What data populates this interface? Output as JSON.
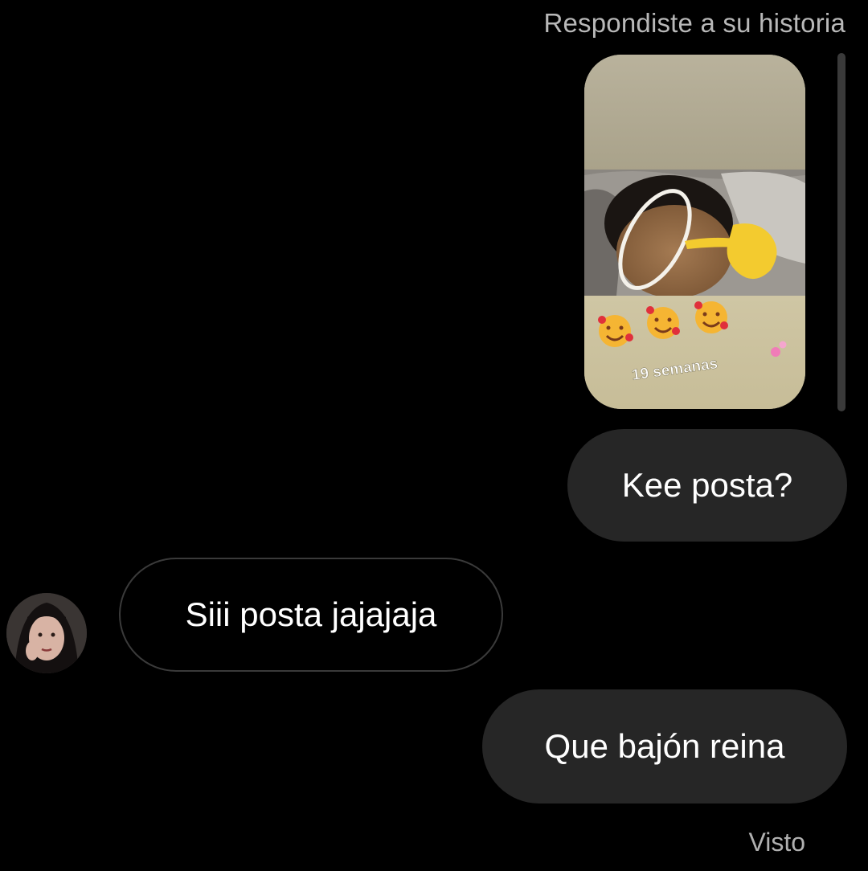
{
  "conversation": {
    "reply_context": "Respondiste a su historia",
    "story": {
      "overlay_text": "19 semanas",
      "stickers": [
        "smiling-face-with-hearts-icon",
        "smiling-face-with-hearts-icon",
        "smiling-face-with-hearts-icon",
        "two-hearts-icon",
        "pointing-hand-icon"
      ]
    },
    "messages": [
      {
        "sender": "me",
        "text": "Kee posta?"
      },
      {
        "sender": "them",
        "text": "Siii posta jajajaja"
      },
      {
        "sender": "me",
        "text": "Que bajón reina"
      }
    ],
    "status": "Visto"
  },
  "colors": {
    "background": "#000000",
    "sent_bubble": "#262626",
    "received_border": "#3a3a3a",
    "secondary_text": "#b8b8b8"
  }
}
